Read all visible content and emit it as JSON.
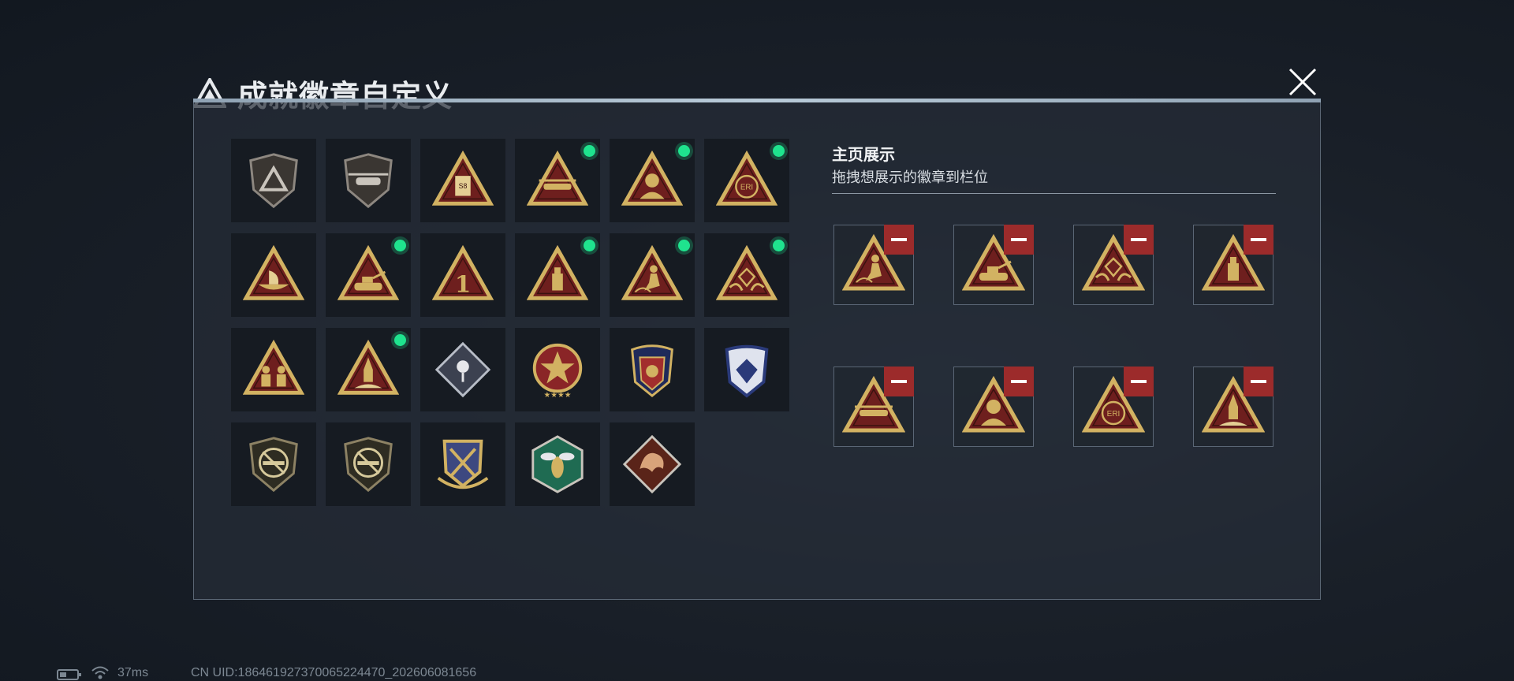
{
  "dialog": {
    "title": "成就徽章自定义",
    "logo_icon": "triangle-a-logo-icon",
    "close_icon": "close-icon"
  },
  "badge_grid": [
    {
      "icon": "shield-logo-badge-icon",
      "equipped": false
    },
    {
      "icon": "helicopter-shield-badge-icon",
      "equipped": false
    },
    {
      "icon": "s8-card-badge-icon",
      "equipped": false
    },
    {
      "icon": "gunship-badge-icon",
      "equipped": true
    },
    {
      "icon": "soldier-portrait-badge-icon",
      "equipped": true
    },
    {
      "icon": "eri-globe-badge-icon",
      "equipped": true
    },
    {
      "icon": "boat-wave-badge-icon",
      "equipped": false
    },
    {
      "icon": "tank-badge-icon",
      "equipped": true
    },
    {
      "icon": "number-one-badge-icon",
      "equipped": false
    },
    {
      "icon": "usb-drive-badge-icon",
      "equipped": true
    },
    {
      "icon": "runner-badge-icon",
      "equipped": true
    },
    {
      "icon": "diamond-hands-badge-icon",
      "equipped": true
    },
    {
      "icon": "squad-soldiers-badge-icon",
      "equipped": false
    },
    {
      "icon": "rocket-launch-badge-icon",
      "equipped": true
    },
    {
      "icon": "rose-diamond-badge-icon",
      "equipped": false
    },
    {
      "icon": "star-medal-badge-icon",
      "equipped": false
    },
    {
      "icon": "crest-stars-badge-icon",
      "equipped": false
    },
    {
      "icon": "diamond-shield-badge-icon",
      "equipped": false
    },
    {
      "icon": "no-rifle-badge-icon",
      "equipped": false
    },
    {
      "icon": "no-smg-badge-icon",
      "equipped": false
    },
    {
      "icon": "crossed-weapons-crest-badge-icon",
      "equipped": false
    },
    {
      "icon": "wasp-hexagon-badge-icon",
      "equipped": false
    },
    {
      "icon": "dragon-diamond-badge-icon",
      "equipped": false
    }
  ],
  "showcase": {
    "title": "主页展示",
    "subtitle": "拖拽想展示的徽章到栏位",
    "slots": [
      {
        "icon": "runner-badge-icon"
      },
      {
        "icon": "tank-badge-icon"
      },
      {
        "icon": "diamond-hands-badge-icon"
      },
      {
        "icon": "usb-drive-badge-icon"
      },
      {
        "icon": "gunship-badge-icon"
      },
      {
        "icon": "soldier-portrait-badge-icon"
      },
      {
        "icon": "eri-globe-badge-icon"
      },
      {
        "icon": "rocket-launch-badge-icon"
      }
    ]
  },
  "status_bar": {
    "ping": "37ms",
    "uid": "CN UID:186461927370065224470_202606081656"
  },
  "colors": {
    "gold": "#d2b262",
    "badge_red": "#6e1f1e",
    "equipped_dot": "#1fe38e",
    "remove_button": "#9c2b2b"
  }
}
